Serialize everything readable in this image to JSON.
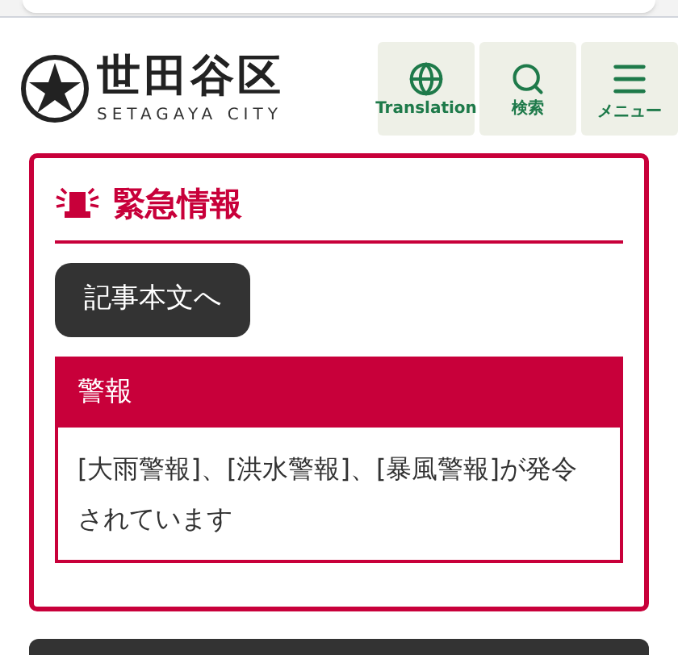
{
  "header": {
    "logo_name": "世田谷区",
    "logo_sub": "SETAGAYA CITY",
    "buttons": [
      {
        "kind": "globe",
        "label": "Translation"
      },
      {
        "kind": "search",
        "label": "検索"
      },
      {
        "kind": "menu",
        "label": "メニュー"
      }
    ]
  },
  "emergency": {
    "title": "緊急情報",
    "link": "記事本文へ",
    "alert": {
      "heading": "警報",
      "message": "[大雨警報]、[洪水警報]、[暴風警報]が発令されています"
    }
  }
}
